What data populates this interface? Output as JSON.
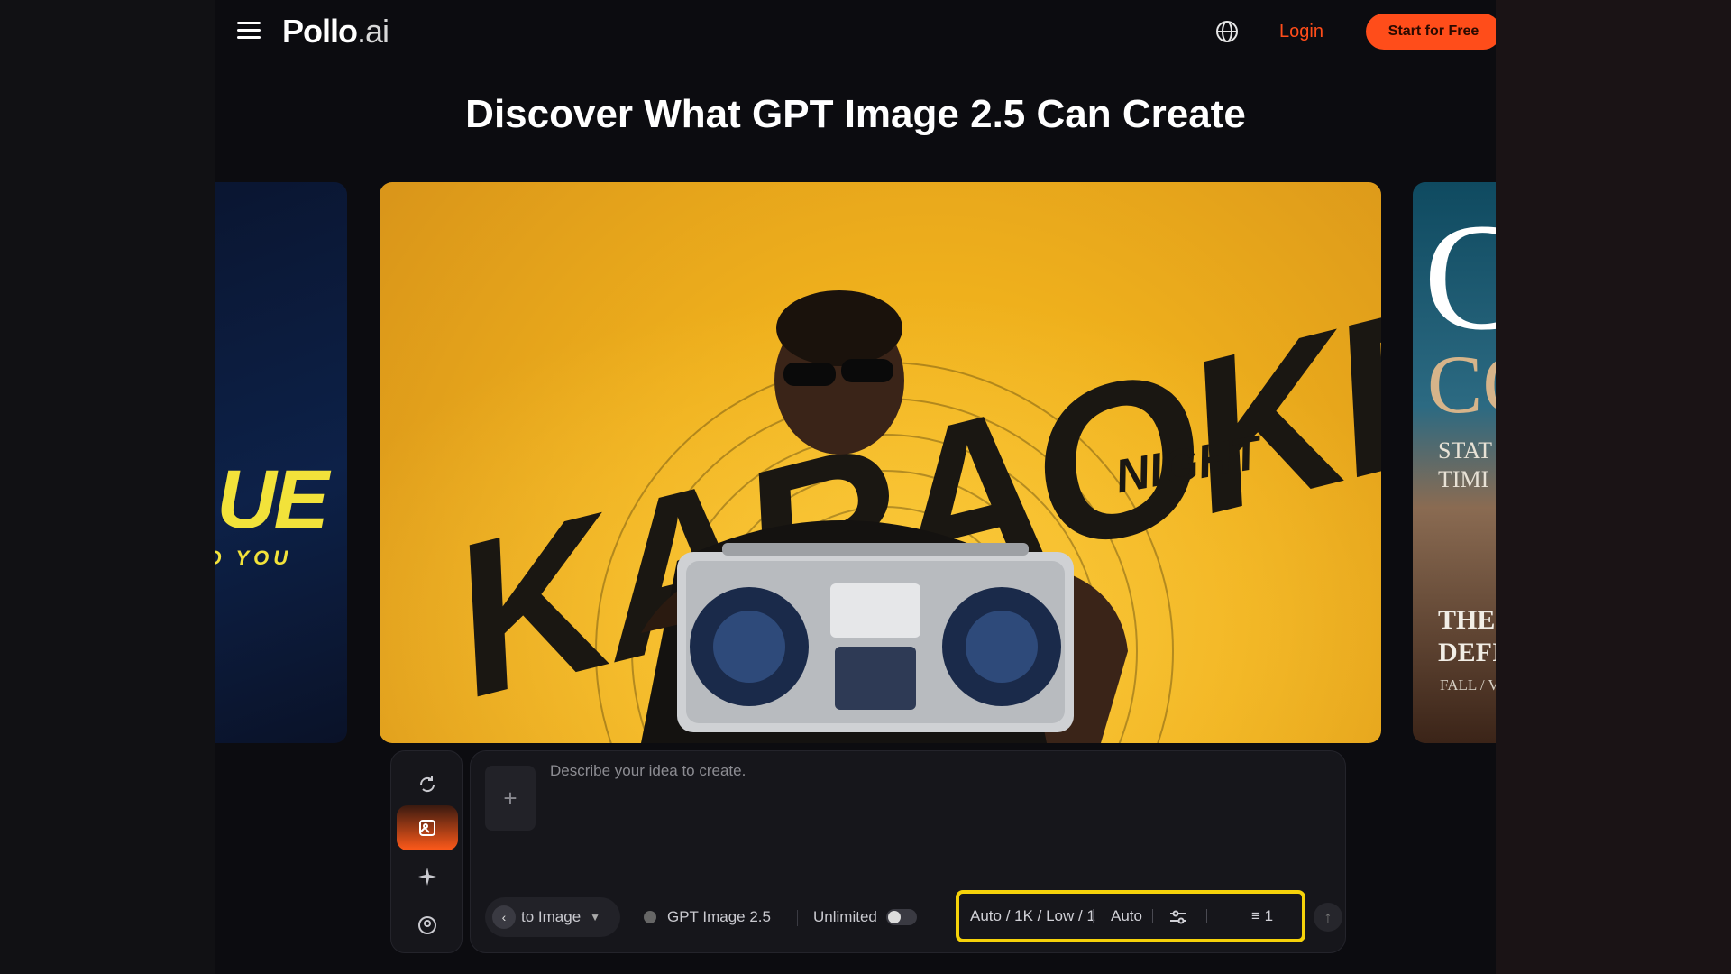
{
  "header": {
    "logo_main": "Pollo",
    "logo_suffix": ".ai",
    "login_label": "Login",
    "cta_label": "Start for Free",
    "menu_icon": "hamburger-menu-icon",
    "language_icon": "globe-icon"
  },
  "page_title": "Discover What GPT Image 2.5 Can Create",
  "carousel": {
    "left_card": {
      "title": "LUE",
      "subtitle": "ND YOU"
    },
    "main_card": {
      "title": "KARAOKE",
      "subtitle": "NIGHT"
    },
    "right_card": {
      "big1": "C",
      "big2": "CO",
      "line1": "STAT",
      "line2": "TIMI",
      "line3": "THE I",
      "line4": "DEFI",
      "line5": "FALL / V"
    }
  },
  "composer": {
    "placeholder": "Describe your idea to create.",
    "add_label": "+",
    "mode_label": "to Image",
    "model_label": "GPT Image 2.5",
    "unlimited_label": "Unlimited",
    "settings_label": "Auto / 1K / Low / 1",
    "aspect_label": "Auto",
    "count_label": "1"
  },
  "colors": {
    "accent": "#ff4d1a",
    "highlight_border": "#f5d20a",
    "poster_yellow": "#f0b41e"
  }
}
